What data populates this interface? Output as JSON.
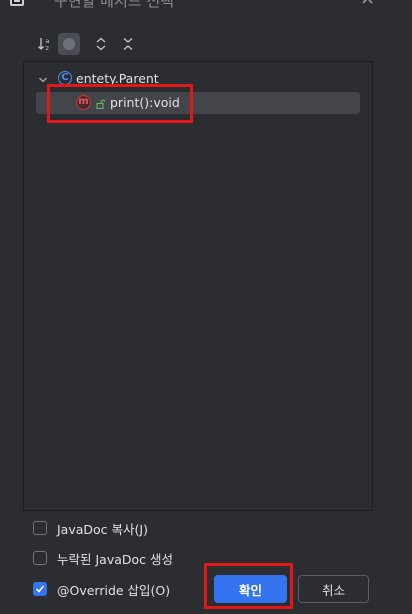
{
  "window": {
    "title": "구현할 메서드 선택",
    "close_glyph": "×"
  },
  "toolbar": {
    "sort_icon": "sort-alpha-icon",
    "show_icon": "circle-toggle-icon",
    "expand_icon": "expand-all-icon",
    "collapse_icon": "collapse-all-icon"
  },
  "tree": {
    "parent": {
      "icon_letter": "C",
      "label": "entety.Parent"
    },
    "method": {
      "icon_letter": "m",
      "label": "print():void",
      "selected": true
    }
  },
  "options": {
    "javadoc_copy": {
      "label": "JavaDoc 복사(J)",
      "checked": false
    },
    "missing_javadoc": {
      "label": "누락된 JavaDoc 생성",
      "checked": false
    },
    "override": {
      "label": "@Override 삽입(O)",
      "checked": true
    }
  },
  "buttons": {
    "ok_label": "확인",
    "cancel_label": "취소"
  },
  "colors": {
    "background": "#2b2d30",
    "accent": "#3574f0",
    "selection": "#43454a",
    "highlight": "#e01818"
  }
}
